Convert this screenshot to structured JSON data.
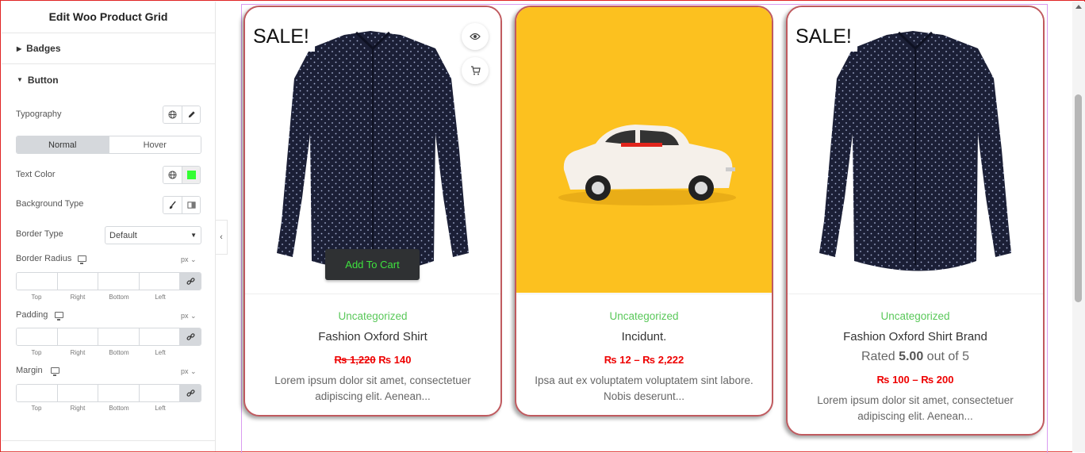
{
  "panel": {
    "title": "Edit Woo Product Grid",
    "badges_label": "Badges",
    "button_label": "Button",
    "typography_label": "Typography",
    "tabs": {
      "normal": "Normal",
      "hover": "Hover"
    },
    "text_color_label": "Text Color",
    "text_color_value": "#33ff33",
    "background_type_label": "Background Type",
    "border_type_label": "Border Type",
    "border_type_value": "Default",
    "border_radius_label": "Border Radius",
    "padding_label": "Padding",
    "margin_label": "Margin",
    "unit": "px",
    "dim_labels": [
      "Top",
      "Right",
      "Bottom",
      "Left"
    ]
  },
  "products": [
    {
      "sale_badge": "SALE!",
      "category": "Uncategorized",
      "name": "Fashion Oxford Shirt",
      "price_old": "₨ 1,220",
      "price_new": "₨ 140",
      "description": "Lorem ipsum dolor sit amet, consectetuer adipiscing elit. Aenean...",
      "add_to_cart": "Add To Cart"
    },
    {
      "category": "Uncategorized",
      "name": "Incidunt.",
      "price_range": "₨ 12 – ₨ 2,222",
      "description": "Ipsa aut ex voluptatem voluptatem sint labore. Nobis deserunt..."
    },
    {
      "sale_badge": "SALE!",
      "category": "Uncategorized",
      "name": "Fashion Oxford Shirt Brand",
      "rating_prefix": "Rated ",
      "rating_value": "5.00",
      "rating_suffix": " out of 5",
      "price_range": "₨ 100 – ₨ 200",
      "description": "Lorem ipsum dolor sit amet, consectetuer adipiscing elit. Aenean..."
    }
  ],
  "colors": {
    "card_border": "#c05a5f",
    "category": "#5ac85a",
    "price": "#e00000",
    "cart_text": "#3fe23f"
  },
  "icons": [
    "eye-icon",
    "cart-icon",
    "globe-icon",
    "pencil-icon",
    "brush-icon",
    "gradient-icon",
    "link-icon",
    "desktop-icon",
    "chevron-left-icon"
  ]
}
